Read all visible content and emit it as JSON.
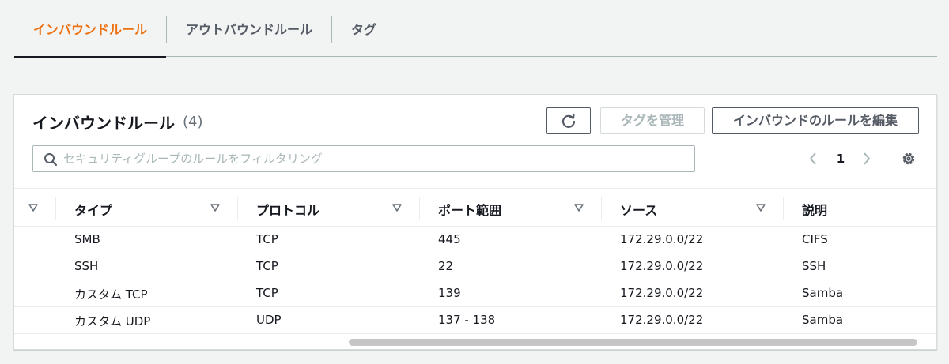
{
  "tabs": [
    {
      "label": "インバウンドルール",
      "active": true
    },
    {
      "label": "アウトバウンドルール",
      "active": false
    },
    {
      "label": "タグ",
      "active": false
    }
  ],
  "panel": {
    "title": "インバウンドルール",
    "count": "(4)",
    "manage_tags_label": "タグを管理",
    "edit_rules_label": "インバウンドのルールを編集",
    "search_placeholder": "セキュリティグループのルールをフィルタリング",
    "search_value": "",
    "page_number": "1"
  },
  "table": {
    "headers": [
      "タイプ",
      "プロトコル",
      "ポート範囲",
      "ソース",
      "説明"
    ],
    "rows": [
      [
        "SMB",
        "TCP",
        "445",
        "172.29.0.0/22",
        "CIFS"
      ],
      [
        "SSH",
        "TCP",
        "22",
        "172.29.0.0/22",
        "SSH"
      ],
      [
        "カスタム TCP",
        "TCP",
        "139",
        "172.29.0.0/22",
        "Samba"
      ],
      [
        "カスタム UDP",
        "UDP",
        "137 - 138",
        "172.29.0.0/22",
        "Samba"
      ]
    ]
  },
  "icons": {
    "refresh": "refresh-icon",
    "search": "search-icon",
    "prev": "chevron-left-icon",
    "next": "chevron-right-icon",
    "settings": "gear-icon",
    "sort": "sort-caret-down-icon"
  },
  "colors": {
    "accent": "#ec7211",
    "text": "#16191f",
    "muted": "#687078",
    "background": "#f2f3f3"
  }
}
